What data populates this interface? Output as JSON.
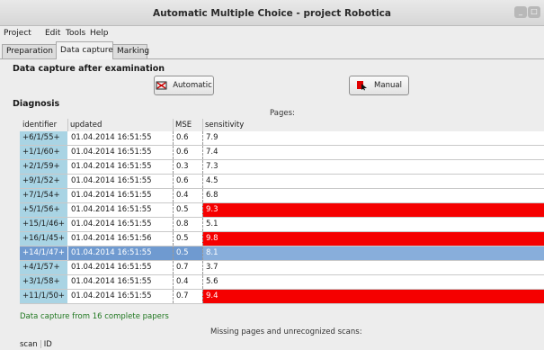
{
  "window": {
    "title": "Automatic Multiple Choice - project Robotica"
  },
  "menu": [
    "Project",
    "Edit",
    "Tools",
    "Help"
  ],
  "tabs": [
    "Preparation",
    "Data capture",
    "Marking"
  ],
  "capture": {
    "section_title": "Data capture after examination",
    "automatic_label": "Automatic",
    "manual_label": "Manual"
  },
  "diagnosis": {
    "section_title": "Diagnosis",
    "pages_label": "Pages:",
    "columns": [
      "identifier",
      "updated",
      "MSE",
      "sensitivity"
    ],
    "rows": [
      {
        "id": "+6/1/55+",
        "updated": "01.04.2014 16:51:55",
        "mse": "0.6",
        "sensitivity": "7.9"
      },
      {
        "id": "+1/1/60+",
        "updated": "01.04.2014 16:51:55",
        "mse": "0.6",
        "sensitivity": "7.4"
      },
      {
        "id": "+2/1/59+",
        "updated": "01.04.2014 16:51:55",
        "mse": "0.3",
        "sensitivity": "7.3"
      },
      {
        "id": "+9/1/52+",
        "updated": "01.04.2014 16:51:55",
        "mse": "0.6",
        "sensitivity": "4.5"
      },
      {
        "id": "+7/1/54+",
        "updated": "01.04.2014 16:51:55",
        "mse": "0.4",
        "sensitivity": "6.8"
      },
      {
        "id": "+5/1/56+",
        "updated": "01.04.2014 16:51:55",
        "mse": "0.5",
        "sensitivity": "9.3"
      },
      {
        "id": "+15/1/46+",
        "updated": "01.04.2014 16:51:55",
        "mse": "0.8",
        "sensitivity": "5.1"
      },
      {
        "id": "+16/1/45+",
        "updated": "01.04.2014 16:51:56",
        "mse": "0.5",
        "sensitivity": "9.8"
      },
      {
        "id": "+14/1/47+",
        "updated": "01.04.2014 16:51:55",
        "mse": "0.5",
        "sensitivity": "8.1"
      },
      {
        "id": "+4/1/57+",
        "updated": "01.04.2014 16:51:55",
        "mse": "0.7",
        "sensitivity": "3.7"
      },
      {
        "id": "+3/1/58+",
        "updated": "01.04.2014 16:51:55",
        "mse": "0.4",
        "sensitivity": "5.6"
      },
      {
        "id": "+11/1/50+",
        "updated": "01.04.2014 16:51:55",
        "mse": "0.7",
        "sensitivity": "9.4"
      }
    ],
    "highlight_color": "#f50000",
    "selected_color": "#6f9ad0"
  },
  "status_text": "Data capture from 16 complete papers",
  "missing": {
    "label": "Missing pages and unrecognized scans:",
    "columns": [
      "scan",
      "ID"
    ]
  }
}
